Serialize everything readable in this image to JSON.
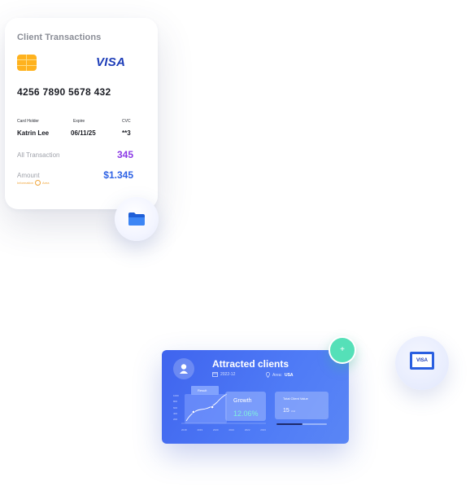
{
  "colors": {
    "accent_blue": "#3f64ee",
    "purple": "#8c3ae6",
    "chip_orange": "#ffb21e",
    "mint": "#55e0b8",
    "growth_teal": "#7ff0dd"
  },
  "transactions_card": {
    "title": "Client Transactions",
    "chip_icon": "card-chip-icon",
    "brand": "VISA",
    "card_number": "4256  7890  5678  432",
    "holder_label": "Card Holder",
    "holder_value": "Katrin Lee",
    "expire_label": "Expire",
    "expire_value": "06/11/25",
    "cvc_label": "CVC",
    "cvc_value": "**3",
    "all_tx_label": "All Transaction",
    "all_tx_value": "345",
    "amount_label": "Amount",
    "amount_sub_left": "Information",
    "amount_sub_right": "Area",
    "amount_value": "$1.345",
    "folder_icon": "folder-icon"
  },
  "clients_card": {
    "title": "Attracted clients",
    "date": "2022-12",
    "location_prefix": "Area:",
    "location": "USA",
    "result_tag": "Result",
    "growth_label": "Growth",
    "growth_value": "12.06%",
    "tcv_label": "Total Client Value",
    "tcv_value": "15",
    "tcv_unit": "Unit",
    "tcv_progress": 0.52,
    "y_ticks": [
      "1000",
      "800",
      "600",
      "400",
      "200"
    ],
    "x_ticks": [
      "2018",
      "2019",
      "2020",
      "2021",
      "2022",
      "2023"
    ],
    "plus_label": "+"
  },
  "visa_bubble": {
    "label": "VISA"
  }
}
